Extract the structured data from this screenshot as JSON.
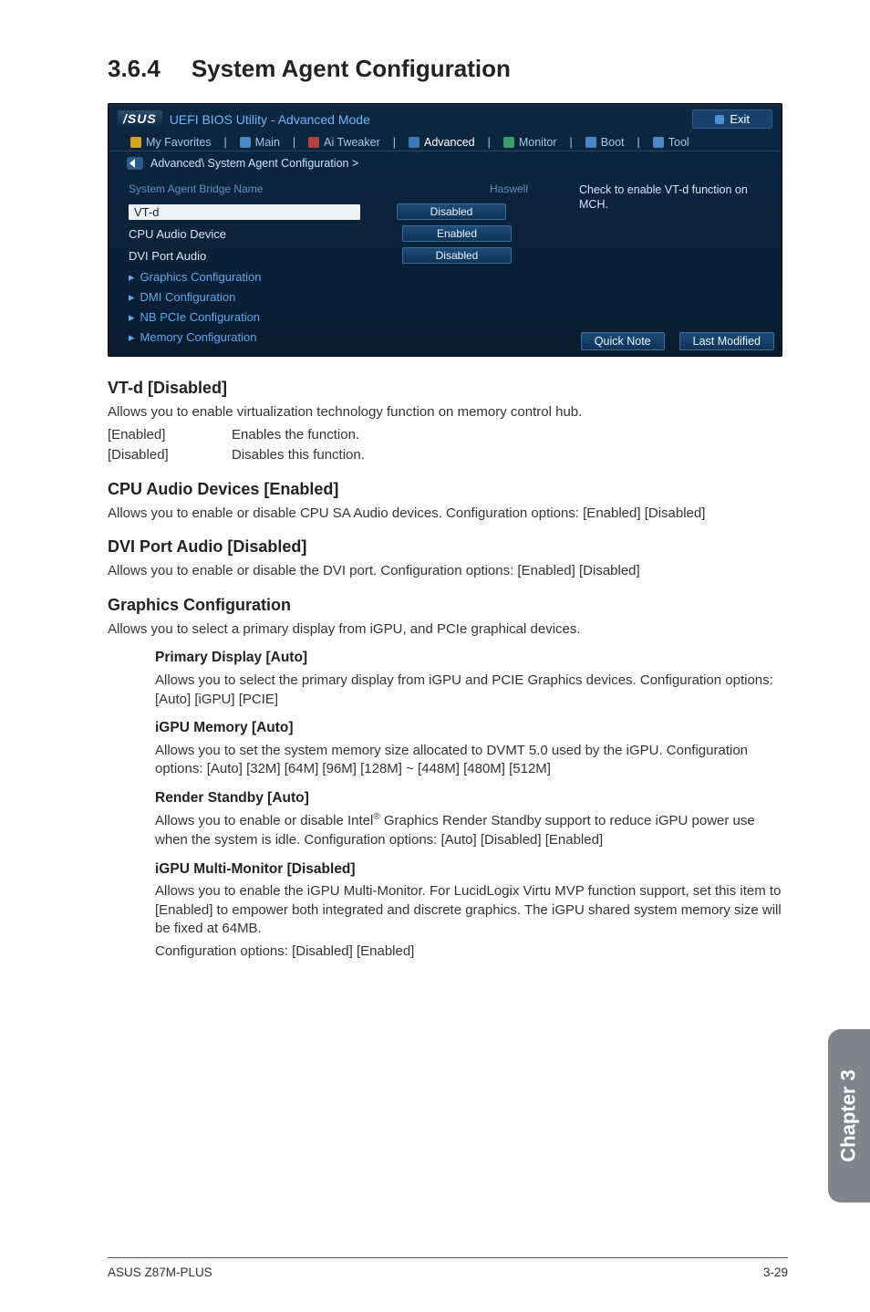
{
  "heading": {
    "number": "3.6.4",
    "title": "System Agent Configuration"
  },
  "bios": {
    "brand": "/SUS",
    "title": "UEFI BIOS Utility - Advanced Mode",
    "exit": "Exit",
    "tabs": {
      "favorites": "My Favorites",
      "main": "Main",
      "tweaker": "Ai Tweaker",
      "advanced": "Advanced",
      "monitor": "Monitor",
      "boot": "Boot",
      "tool": "Tool"
    },
    "breadcrumb": "Advanced\\ System Agent Configuration >",
    "bridge": {
      "label": "System Agent Bridge Name",
      "value": "Haswell"
    },
    "rows": {
      "vtd": {
        "label": "VT-d",
        "value": "Disabled"
      },
      "cpuAudio": {
        "label": "CPU Audio Device",
        "value": "Enabled"
      },
      "dvi": {
        "label": "DVI Port Audio",
        "value": "Disabled"
      }
    },
    "links": {
      "graphics": "Graphics Configuration",
      "dmi": "DMI Configuration",
      "nbpcie": "NB PCIe Configuration",
      "memory": "Memory Configuration"
    },
    "help": "Check to enable VT-d function on MCH.",
    "bottom": {
      "quick": "Quick Note",
      "last": "Last Modified"
    }
  },
  "doc": {
    "vtd": {
      "h": "VT-d [Disabled]",
      "p": "Allows you to enable virtualization technology function on memory control hub.",
      "en_k": "[Enabled]",
      "en_v": "Enables the function.",
      "di_k": "[Disabled]",
      "di_v": "Disables this function."
    },
    "cpuAudio": {
      "h": "CPU Audio Devices [Enabled]",
      "p": "Allows you to enable or disable CPU SA Audio devices. Configuration options: [Enabled] [Disabled]"
    },
    "dvi": {
      "h": "DVI Port Audio [Disabled]",
      "p": "Allows you to enable or disable the DVI port. Configuration options: [Enabled] [Disabled]"
    },
    "gfx": {
      "h": "Graphics Configuration",
      "p": "Allows you to select a primary display from iGPU, and PCIe graphical devices.",
      "primary": {
        "h": "Primary Display [Auto]",
        "p": "Allows you to select the primary display from iGPU and PCIE Graphics devices. Configuration options: [Auto] [iGPU] [PCIE]"
      },
      "igpuMem": {
        "h": "iGPU Memory [Auto]",
        "p": "Allows you to set the system memory size allocated to DVMT 5.0 used by the iGPU. Configuration options: [Auto] [32M] [64M] [96M] [128M] ~ [448M] [480M] [512M]"
      },
      "render": {
        "h": "Render Standby [Auto]",
        "p1": "Allows you to enable or disable Intel",
        "p2": " Graphics Render Standby support to reduce iGPU power use when the system is idle. Configuration options: [Auto] [Disabled] [Enabled]"
      },
      "multi": {
        "h": "iGPU Multi-Monitor [Disabled]",
        "p": "Allows you to enable the iGPU Multi-Monitor. For LucidLogix Virtu MVP function support, set this item to [Enabled] to empower both integrated and discrete graphics. The iGPU shared system memory size will be fixed at 64MB.",
        "p2": "Configuration options: [Disabled] [Enabled]"
      }
    }
  },
  "sideTab": "Chapter 3",
  "footer": {
    "left": "ASUS Z87M-PLUS",
    "right": "3-29"
  }
}
